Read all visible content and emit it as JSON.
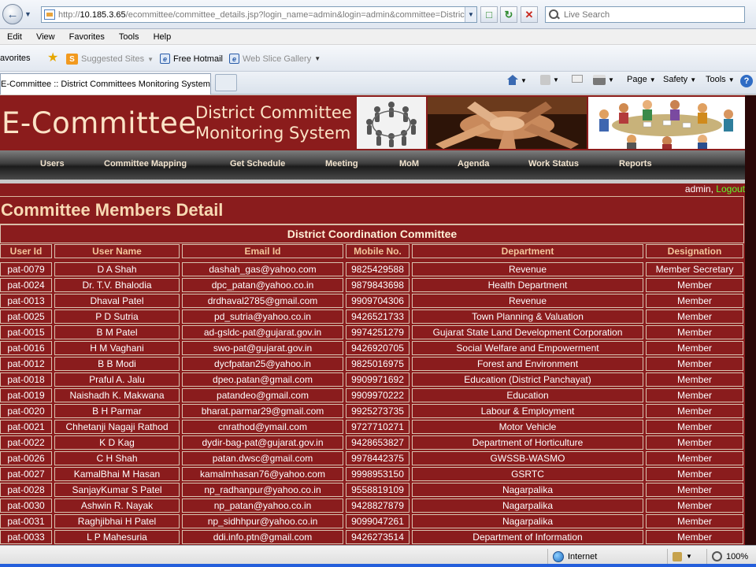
{
  "browser": {
    "url_prefix": "http://",
    "url_host": "10.185.3.65",
    "url_path": "/ecommittee/committee_details.jsp?login_name=admin&login=admin&committee=Distric",
    "search_placeholder": "Live Search",
    "menu": [
      "Edit",
      "View",
      "Favorites",
      "Tools",
      "Help"
    ],
    "favorites_label": "avorites",
    "fav_links": [
      "Suggested Sites",
      "Free Hotmail",
      "Web Slice Gallery"
    ],
    "tab_title": "E-Committee :: District Committees Monitoring System",
    "commands": [
      "Page",
      "Safety",
      "Tools"
    ]
  },
  "header": {
    "brand": "E-Committee",
    "subtitle_line1": "District Committee",
    "subtitle_line2": "Monitoring System"
  },
  "nav": [
    "Users",
    "Committee Mapping",
    "Get Schedule",
    "Meeting",
    "MoM",
    "Agenda",
    "Work Status",
    "Reports"
  ],
  "user": {
    "name": "admin,",
    "logout": "Logout"
  },
  "page_title": "Committee Members Detail",
  "committee_name": "District Coordination Committee",
  "table": {
    "columns": [
      "User Id",
      "User Name",
      "Email Id",
      "Mobile No.",
      "Department",
      "Designation"
    ],
    "rows": [
      [
        "pat-0079",
        "D A Shah",
        "dashah_gas@yahoo.com",
        "9825429588",
        "Revenue",
        "Member Secretary"
      ],
      [
        "pat-0024",
        "Dr. T.V. Bhalodia",
        "dpc_patan@yahoo.co.in",
        "9879843698",
        "Health Department",
        "Member"
      ],
      [
        "pat-0013",
        "Dhaval Patel",
        "drdhaval2785@gmail.com",
        "9909704306",
        "Revenue",
        "Member"
      ],
      [
        "pat-0025",
        "P D Sutria",
        "pd_sutria@yahoo.co.in",
        "9426521733",
        "Town Planning & Valuation",
        "Member"
      ],
      [
        "pat-0015",
        "B M Patel",
        "ad-gsldc-pat@gujarat.gov.in",
        "9974251279",
        "Gujarat State Land Development Corporation",
        "Member"
      ],
      [
        "pat-0016",
        "H M Vaghani",
        "swo-pat@gujarat.gov.in",
        "9426920705",
        "Social Welfare and Empowerment",
        "Member"
      ],
      [
        "pat-0012",
        "B B Modi",
        "dycfpatan25@yahoo.in",
        "9825016975",
        "Forest and Environment",
        "Member"
      ],
      [
        "pat-0018",
        "Praful A. Jalu",
        "dpeo.patan@gmail.com",
        "9909971692",
        "Education (District Panchayat)",
        "Member"
      ],
      [
        "pat-0019",
        "Naishadh K. Makwana",
        "patandeo@gmail.com",
        "9909970222",
        "Education",
        "Member"
      ],
      [
        "pat-0020",
        "B H Parmar",
        "bharat.parmar29@gmail.com",
        "9925273735",
        "Labour & Employment",
        "Member"
      ],
      [
        "pat-0021",
        "Chhetanji Nagaji Rathod",
        "cnrathod@ymail.com",
        "9727710271",
        "Motor Vehicle",
        "Member"
      ],
      [
        "pat-0022",
        "K D Kag",
        "dydir-bag-pat@gujarat.gov.in",
        "9428653827",
        "Department of Horticulture",
        "Member"
      ],
      [
        "pat-0026",
        "C H Shah",
        "patan.dwsc@gmail.com",
        "9978442375",
        "GWSSB-WASMO",
        "Member"
      ],
      [
        "pat-0027",
        "KamalBhai M Hasan",
        "kamalmhasan76@yahoo.com",
        "9998953150",
        "GSRTC",
        "Member"
      ],
      [
        "pat-0028",
        "SanjayKumar S Patel",
        "np_radhanpur@yahoo.co.in",
        "9558819109",
        "Nagarpalika",
        "Member"
      ],
      [
        "pat-0030",
        "Ashwin R. Nayak",
        "np_patan@yahoo.co.in",
        "9428827879",
        "Nagarpalika",
        "Member"
      ],
      [
        "pat-0031",
        "Raghjibhai H Patel",
        "np_sidhhpur@yahoo.co.in",
        "9099047261",
        "Nagarpalika",
        "Member"
      ],
      [
        "pat-0033",
        "L P Mahesuria",
        "ddi.info.ptn@gmail.com",
        "9426273514",
        "Department of Information",
        "Member"
      ]
    ]
  },
  "status": {
    "zone": "Internet",
    "zoom": "100%"
  },
  "colors": {
    "page_bg": "#8a1c1d",
    "header_text": "#fbe3c6",
    "logout": "#5cff2b",
    "nav_text": "#f2e4cf"
  }
}
